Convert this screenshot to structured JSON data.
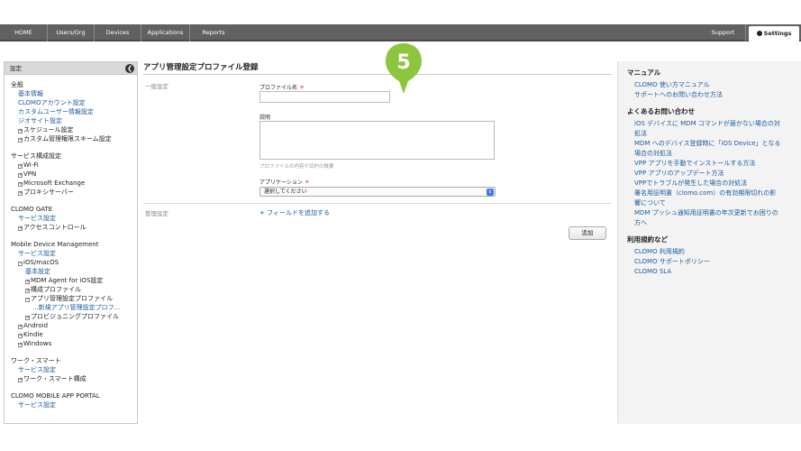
{
  "nav": {
    "items": [
      "HOME",
      "Users/Org",
      "Devices",
      "Applications",
      "Reports"
    ],
    "support": "Support",
    "settings": "Settings"
  },
  "sidebar": {
    "header": "設定",
    "collapse_glyph": "❮",
    "sections": [
      {
        "title": "全般",
        "links": [
          "基本情報",
          "CLOMOアカウント設定",
          "カスタムユーザー情報設定",
          "ジオサイト設定"
        ],
        "tree": [
          "スケジュール設定",
          "カスタム管理権限スキーム設定"
        ]
      },
      {
        "title": "サービス構成設定",
        "tree": [
          "Wi-Fi",
          "VPN",
          "Microsoft Exchange",
          "プロキシサーバー"
        ]
      },
      {
        "title": "CLOMO GATE",
        "links": [
          "サービス設定"
        ],
        "tree": [
          "アクセスコントロール"
        ]
      },
      {
        "title": "Mobile Device Management",
        "links": [
          "サービス設定"
        ]
      }
    ],
    "mdm": {
      "ios": "iOS/macOS",
      "basic": "基本設定",
      "agent": "MDM Agent for iOS設定",
      "profile": "構成プロファイル",
      "app_profile": "アプリ管理設定プロファイル",
      "new_app_profile": "...新規アプリ管理設定プロフ...",
      "provisioning": "プロビジョニングプロファイル",
      "android": "Android",
      "kindle": "Kindle",
      "windows": "Windows"
    },
    "work": {
      "title": "ワーク・スマート",
      "link": "サービス設定",
      "tree": "ワーク・スマート構成"
    },
    "portal": {
      "title": "CLOMO MOBILE APP PORTAL",
      "link": "サービス設定"
    }
  },
  "main": {
    "title": "アプリ管理設定プロファイル登録",
    "general": "一般設定",
    "profile_name_label": "プロファイル名",
    "required_mark": "＊",
    "profile_name_value": "",
    "description_label": "説明",
    "description_value": "",
    "description_hint": "プロファイルの内容や目的の概要",
    "application_label": "アプリケーション",
    "application_selected": "選択してください",
    "manage": "管理設定",
    "add_field": "+ フィールドを追加する",
    "add_button": "追加"
  },
  "callout": {
    "number": "5"
  },
  "right": {
    "manual_title": "マニュアル",
    "manual_links": [
      "CLOMO 使い方マニュアル",
      "サポートへのお問い合わせ方法"
    ],
    "faq_title": "よくあるお問い合わせ",
    "faq_links": [
      "iOS デバイスに MDM コマンドが届かない場合の対",
      "処法",
      "MDM へのデバイス登録時に「iOS Device」となる",
      "場合の対処法",
      "VPP アプリを手動でインストールする方法",
      "VPP アプリのアップデート方法",
      "VPPでトラブルが発生した場合の対処法",
      "署名用証明書（clomo.com）の有効期限切れの影",
      "響について",
      "MDM プッシュ通知用証明書の年次更新でお困りの",
      "方へ"
    ],
    "terms_title": "利用規約など",
    "terms_links": [
      "CLOMO 利用規約",
      "CLOMO サポートポリシー",
      "CLOMO SLA"
    ]
  },
  "colors": {
    "nav": "#616161",
    "link": "#1a5b9e",
    "callout": "#8cc63f",
    "required": "#d22222"
  }
}
